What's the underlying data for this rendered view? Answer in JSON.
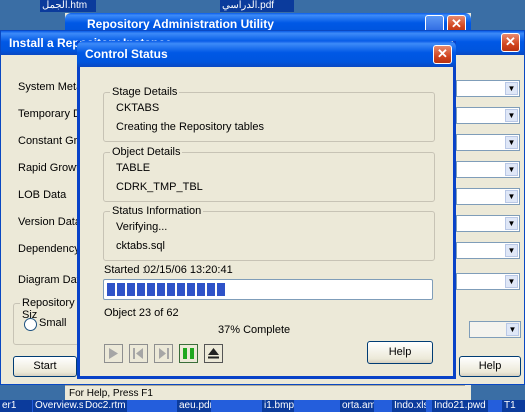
{
  "desktop": {
    "top_left_label": "الجمل.htm",
    "top_right_label": "الدراسي.pdf",
    "bottom_labels": [
      "er1",
      "Overview.sw",
      "Doc2.rtm",
      "aeu.pdr",
      "i1.bmp",
      "orta.am",
      "Indo.xls",
      "Indo21.pwd",
      "T1"
    ]
  },
  "repo_admin": {
    "title": "Repository Administration Utility"
  },
  "install": {
    "title": "Install a Repository Instance",
    "rows": [
      "System Meta-D",
      "Temporary Dat",
      "Constant Grow",
      "Rapid Growth I",
      "LOB Data",
      "Version Data",
      "Dependency D",
      "Diagram Data"
    ],
    "size_group_label": "Repository Siz",
    "size_option_small": "Small",
    "start_button": "Start",
    "help_button": "Help"
  },
  "statusbar": {
    "text": "For Help, Press F1"
  },
  "dialog": {
    "title": "Control Status",
    "stage": {
      "legend": "Stage Details",
      "line1": "CKTABS",
      "line2": "Creating the Repository tables"
    },
    "object": {
      "legend": "Object Details",
      "line1": "TABLE",
      "line2": "CDRK_TMP_TBL"
    },
    "status": {
      "legend": "Status Information",
      "line1": "Verifying...",
      "line2": "cktabs.sql"
    },
    "started_label": "Started :",
    "started_value": "02/15/06 13:20:41",
    "progress_fraction": 0.37,
    "object_count": "Object 23 of 62",
    "percent_complete": "37% Complete",
    "help_button": "Help"
  },
  "colors": {
    "accent": "#0058e6",
    "progress": "#2f53c8",
    "pause_green": "#1fa81f"
  }
}
